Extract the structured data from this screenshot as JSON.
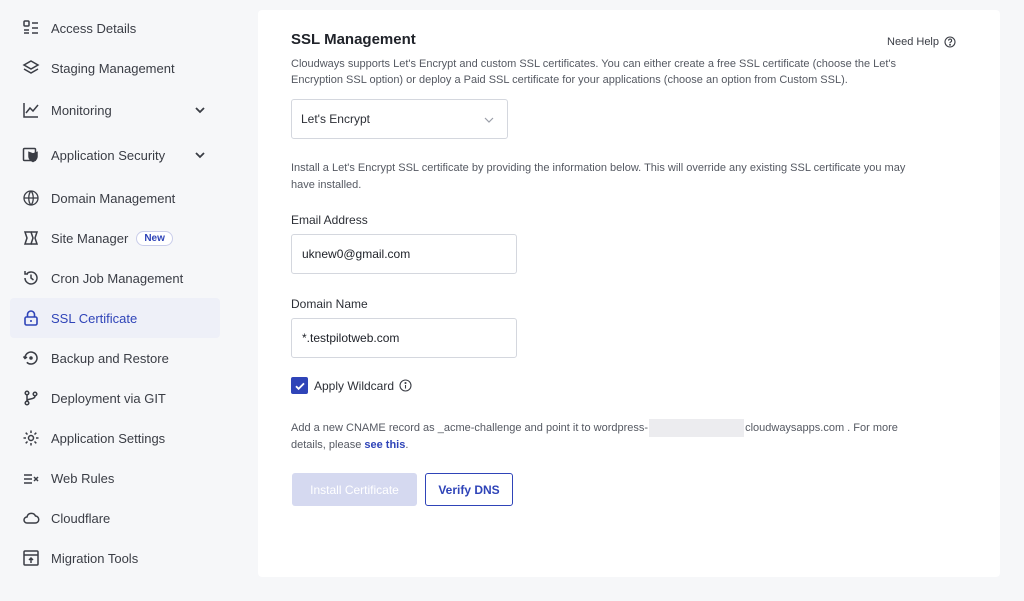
{
  "sidebar": {
    "items": [
      {
        "label": "Access Details"
      },
      {
        "label": "Staging Management"
      },
      {
        "label": "Monitoring"
      },
      {
        "label": "Application Security"
      },
      {
        "label": "Domain Management"
      },
      {
        "label": "Site Manager",
        "badge": "New"
      },
      {
        "label": "Cron Job Management"
      },
      {
        "label": "SSL Certificate"
      },
      {
        "label": "Backup and Restore"
      },
      {
        "label": "Deployment via GIT"
      },
      {
        "label": "Application Settings"
      },
      {
        "label": "Web Rules"
      },
      {
        "label": "Cloudflare"
      },
      {
        "label": "Migration Tools"
      }
    ],
    "active_color": "#2f44b8"
  },
  "main": {
    "title": "SSL Management",
    "help": "Need Help",
    "description": "Cloudways supports Let's Encrypt and custom SSL certificates. You can either create a free SSL certificate (choose the Let's Encryption SSL option) or deploy a Paid SSL certificate for your applications (choose an option from Custom SSL).",
    "ssl_type": "Let's Encrypt",
    "info": "Install a Let's Encrypt SSL certificate by providing the information below. This will override any existing SSL certificate you may have installed.",
    "email_label": "Email Address",
    "email_value": "uknew0@gmail.com",
    "domain_label": "Domain Name",
    "domain_value": "*.testpilotweb.com",
    "wildcard_label": "Apply Wildcard",
    "cname_prefix": "Add a new CNAME record as _acme-challenge and point it to wordpress-",
    "cname_suffix": "cloudwaysapps.com . For more details, please",
    "cname_link": "see this",
    "cname_end": ".",
    "install_button": "Install Certificate",
    "verify_button": "Verify DNS"
  }
}
